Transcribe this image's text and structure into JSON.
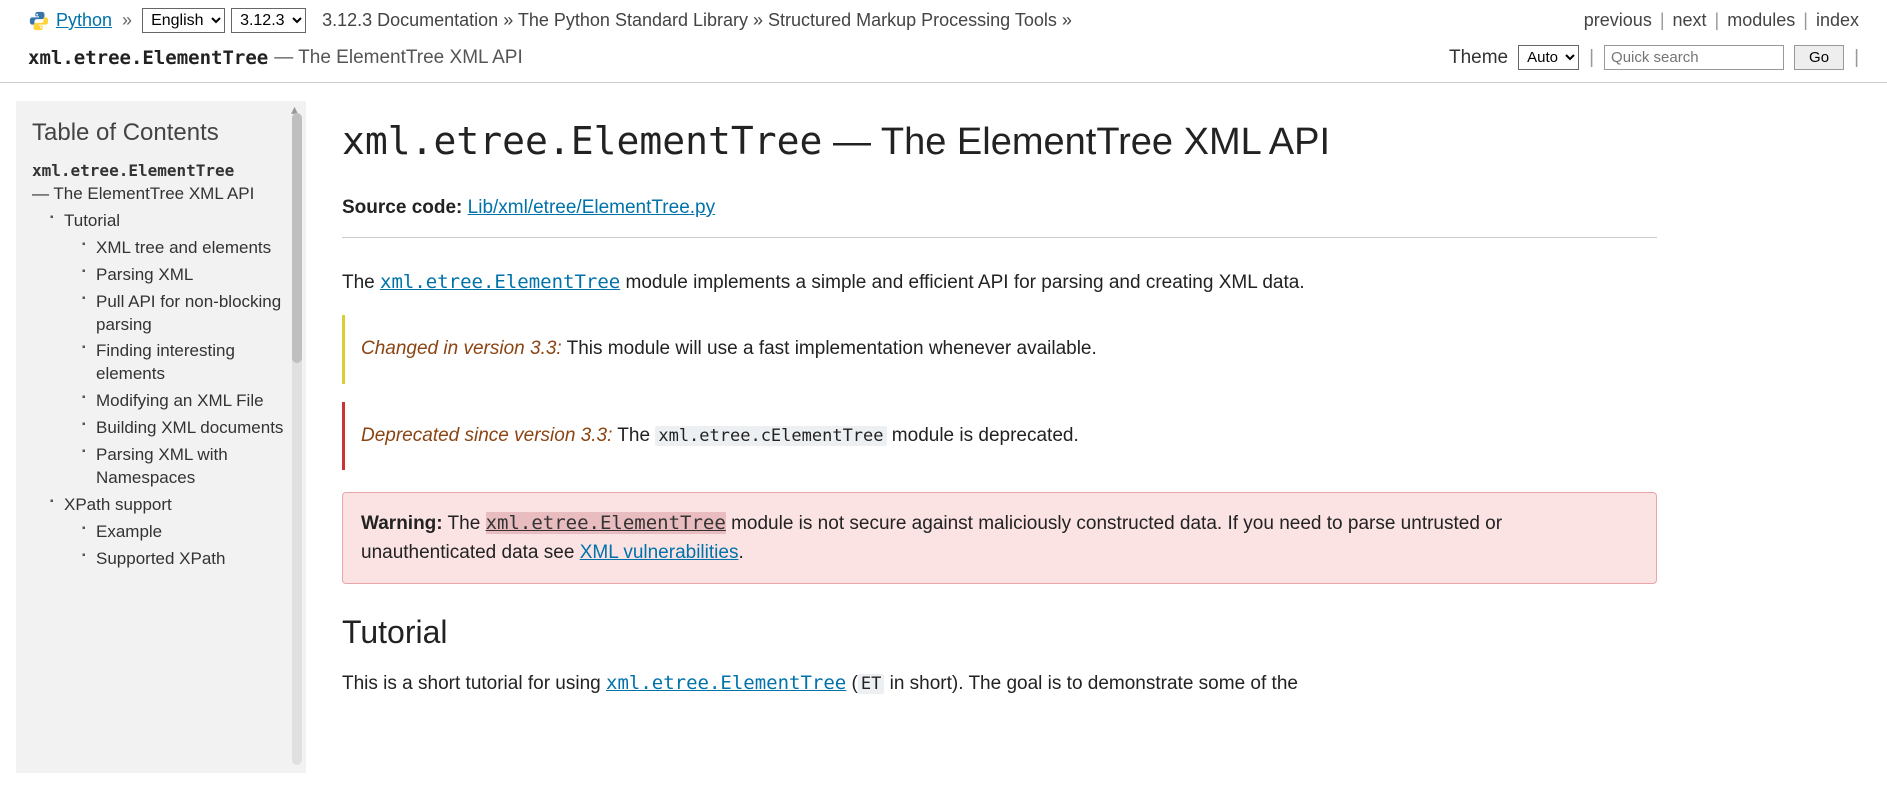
{
  "header": {
    "python_link": "Python",
    "language_selected": "English",
    "version_selected": "3.12.3",
    "breadcrumbs": {
      "b1": "3.12.3 Documentation",
      "b2": "The Python Standard Library",
      "b3": "Structured Markup Processing Tools"
    },
    "nav": {
      "previous": "previous",
      "next": "next",
      "modules": "modules",
      "index": "index"
    }
  },
  "subheader": {
    "module": "xml.etree.ElementTree",
    "dash": " — ",
    "subtitle": "The ElementTree XML API",
    "theme_label": "Theme",
    "theme_selected": "Auto",
    "search_placeholder": "Quick search",
    "go": "Go"
  },
  "sidebar": {
    "title": "Table of Contents",
    "root_module": "xml.etree.ElementTree",
    "root_sub": " — The ElementTree XML API",
    "items": {
      "tutorial": "Tutorial",
      "xml_tree": "XML tree and elements",
      "parsing_xml": "Parsing XML",
      "pull_api": "Pull API for non-blocking parsing",
      "finding": "Finding interesting elements",
      "modifying": "Modifying an XML File",
      "building": "Building XML documents",
      "parsing_ns": "Parsing XML with Namespaces",
      "xpath": "XPath support",
      "example": "Example",
      "supported_xpath": "Supported XPath"
    }
  },
  "main": {
    "title_mono": "xml.etree.ElementTree",
    "title_dash": " — ",
    "title_rest": "The ElementTree XML API",
    "source_label": "Source code:",
    "source_link": "Lib/xml/etree/ElementTree.py",
    "intro_pre": "The ",
    "intro_code": "xml.etree.ElementTree",
    "intro_post": " module implements a simple and efficient API for parsing and creating XML data.",
    "changed_label": "Changed in version 3.3:",
    "changed_text": " This module will use a fast implementation whenever available.",
    "deprecated_label": "Deprecated since version 3.3:",
    "deprecated_pre": " The ",
    "deprecated_code": "xml.etree.cElementTree",
    "deprecated_post": " module is deprecated.",
    "warning_label": "Warning:",
    "warning_pre": "   The ",
    "warning_code": "xml.etree.ElementTree",
    "warning_mid": " module is not secure against maliciously constructed data. If you need to parse untrusted or unauthenticated data see ",
    "warning_link": "XML vulnerabilities",
    "warning_end": ".",
    "tutorial_heading": "Tutorial",
    "tutorial_p_pre": "This is a short tutorial for using ",
    "tutorial_p_code1": "xml.etree.ElementTree",
    "tutorial_p_mid": " (",
    "tutorial_p_code2": "ET",
    "tutorial_p_post": " in short). The goal is to demonstrate some of the"
  }
}
